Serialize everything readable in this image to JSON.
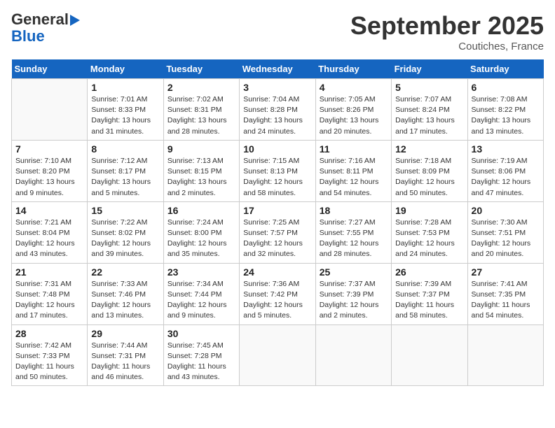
{
  "header": {
    "logo_general": "General",
    "logo_blue": "Blue",
    "month_title": "September 2025",
    "location": "Coutiches, France"
  },
  "days_of_week": [
    "Sunday",
    "Monday",
    "Tuesday",
    "Wednesday",
    "Thursday",
    "Friday",
    "Saturday"
  ],
  "weeks": [
    [
      {
        "day": "",
        "info": ""
      },
      {
        "day": "1",
        "info": "Sunrise: 7:01 AM\nSunset: 8:33 PM\nDaylight: 13 hours\nand 31 minutes."
      },
      {
        "day": "2",
        "info": "Sunrise: 7:02 AM\nSunset: 8:31 PM\nDaylight: 13 hours\nand 28 minutes."
      },
      {
        "day": "3",
        "info": "Sunrise: 7:04 AM\nSunset: 8:28 PM\nDaylight: 13 hours\nand 24 minutes."
      },
      {
        "day": "4",
        "info": "Sunrise: 7:05 AM\nSunset: 8:26 PM\nDaylight: 13 hours\nand 20 minutes."
      },
      {
        "day": "5",
        "info": "Sunrise: 7:07 AM\nSunset: 8:24 PM\nDaylight: 13 hours\nand 17 minutes."
      },
      {
        "day": "6",
        "info": "Sunrise: 7:08 AM\nSunset: 8:22 PM\nDaylight: 13 hours\nand 13 minutes."
      }
    ],
    [
      {
        "day": "7",
        "info": "Sunrise: 7:10 AM\nSunset: 8:20 PM\nDaylight: 13 hours\nand 9 minutes."
      },
      {
        "day": "8",
        "info": "Sunrise: 7:12 AM\nSunset: 8:17 PM\nDaylight: 13 hours\nand 5 minutes."
      },
      {
        "day": "9",
        "info": "Sunrise: 7:13 AM\nSunset: 8:15 PM\nDaylight: 13 hours\nand 2 minutes."
      },
      {
        "day": "10",
        "info": "Sunrise: 7:15 AM\nSunset: 8:13 PM\nDaylight: 12 hours\nand 58 minutes."
      },
      {
        "day": "11",
        "info": "Sunrise: 7:16 AM\nSunset: 8:11 PM\nDaylight: 12 hours\nand 54 minutes."
      },
      {
        "day": "12",
        "info": "Sunrise: 7:18 AM\nSunset: 8:09 PM\nDaylight: 12 hours\nand 50 minutes."
      },
      {
        "day": "13",
        "info": "Sunrise: 7:19 AM\nSunset: 8:06 PM\nDaylight: 12 hours\nand 47 minutes."
      }
    ],
    [
      {
        "day": "14",
        "info": "Sunrise: 7:21 AM\nSunset: 8:04 PM\nDaylight: 12 hours\nand 43 minutes."
      },
      {
        "day": "15",
        "info": "Sunrise: 7:22 AM\nSunset: 8:02 PM\nDaylight: 12 hours\nand 39 minutes."
      },
      {
        "day": "16",
        "info": "Sunrise: 7:24 AM\nSunset: 8:00 PM\nDaylight: 12 hours\nand 35 minutes."
      },
      {
        "day": "17",
        "info": "Sunrise: 7:25 AM\nSunset: 7:57 PM\nDaylight: 12 hours\nand 32 minutes."
      },
      {
        "day": "18",
        "info": "Sunrise: 7:27 AM\nSunset: 7:55 PM\nDaylight: 12 hours\nand 28 minutes."
      },
      {
        "day": "19",
        "info": "Sunrise: 7:28 AM\nSunset: 7:53 PM\nDaylight: 12 hours\nand 24 minutes."
      },
      {
        "day": "20",
        "info": "Sunrise: 7:30 AM\nSunset: 7:51 PM\nDaylight: 12 hours\nand 20 minutes."
      }
    ],
    [
      {
        "day": "21",
        "info": "Sunrise: 7:31 AM\nSunset: 7:48 PM\nDaylight: 12 hours\nand 17 minutes."
      },
      {
        "day": "22",
        "info": "Sunrise: 7:33 AM\nSunset: 7:46 PM\nDaylight: 12 hours\nand 13 minutes."
      },
      {
        "day": "23",
        "info": "Sunrise: 7:34 AM\nSunset: 7:44 PM\nDaylight: 12 hours\nand 9 minutes."
      },
      {
        "day": "24",
        "info": "Sunrise: 7:36 AM\nSunset: 7:42 PM\nDaylight: 12 hours\nand 5 minutes."
      },
      {
        "day": "25",
        "info": "Sunrise: 7:37 AM\nSunset: 7:39 PM\nDaylight: 12 hours\nand 2 minutes."
      },
      {
        "day": "26",
        "info": "Sunrise: 7:39 AM\nSunset: 7:37 PM\nDaylight: 11 hours\nand 58 minutes."
      },
      {
        "day": "27",
        "info": "Sunrise: 7:41 AM\nSunset: 7:35 PM\nDaylight: 11 hours\nand 54 minutes."
      }
    ],
    [
      {
        "day": "28",
        "info": "Sunrise: 7:42 AM\nSunset: 7:33 PM\nDaylight: 11 hours\nand 50 minutes."
      },
      {
        "day": "29",
        "info": "Sunrise: 7:44 AM\nSunset: 7:31 PM\nDaylight: 11 hours\nand 46 minutes."
      },
      {
        "day": "30",
        "info": "Sunrise: 7:45 AM\nSunset: 7:28 PM\nDaylight: 11 hours\nand 43 minutes."
      },
      {
        "day": "",
        "info": ""
      },
      {
        "day": "",
        "info": ""
      },
      {
        "day": "",
        "info": ""
      },
      {
        "day": "",
        "info": ""
      }
    ]
  ]
}
